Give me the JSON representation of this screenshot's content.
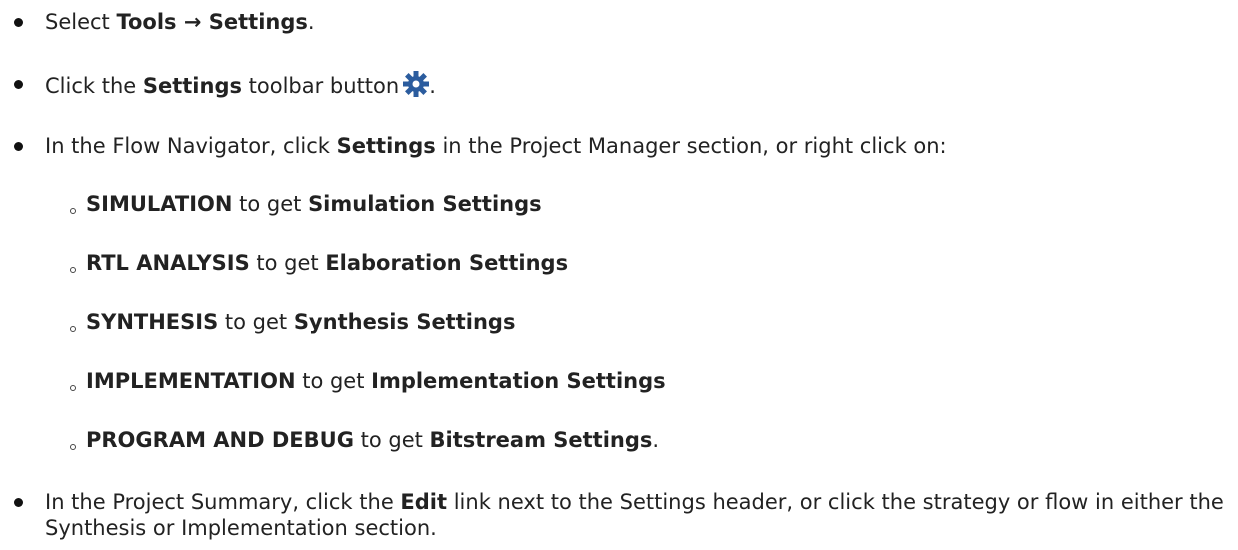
{
  "items": [
    {
      "prefix": "Select ",
      "bold": "Tools",
      "arrow": " → ",
      "bold2": "Settings",
      "suffix": "."
    },
    {
      "prefix": "Click the ",
      "bold": "Settings",
      "suffix": " toolbar button",
      "icon": "gear-icon",
      "end": "."
    },
    {
      "prefix": "In the Flow Navigator, click ",
      "bold": "Settings",
      "suffix": " in the Project Manager section, or right click on:"
    }
  ],
  "subitems": [
    {
      "bold": "SIMULATION",
      "middle": " to get ",
      "bold2": "Simulation Settings",
      "end": ""
    },
    {
      "bold": "RTL ANALYSIS",
      "middle": " to get ",
      "bold2": "Elaboration Settings",
      "end": ""
    },
    {
      "bold": "SYNTHESIS",
      "middle": " to get ",
      "bold2": "Synthesis Settings",
      "end": ""
    },
    {
      "bold": "IMPLEMENTATION",
      "middle": " to get ",
      "bold2": "Implementation Settings",
      "end": ""
    },
    {
      "bold": "PROGRAM AND DEBUG",
      "middle": " to get ",
      "bold2": "Bitstream Settings",
      "end": "."
    }
  ],
  "last_item": {
    "prefix": "In the Project Summary, click the ",
    "bold": "Edit",
    "suffix": " link next to the Settings header, or click the strategy or flow in either the Synthesis or Implementation section."
  },
  "colors": {
    "gear": "#2b5c9e",
    "text": "#222222"
  }
}
